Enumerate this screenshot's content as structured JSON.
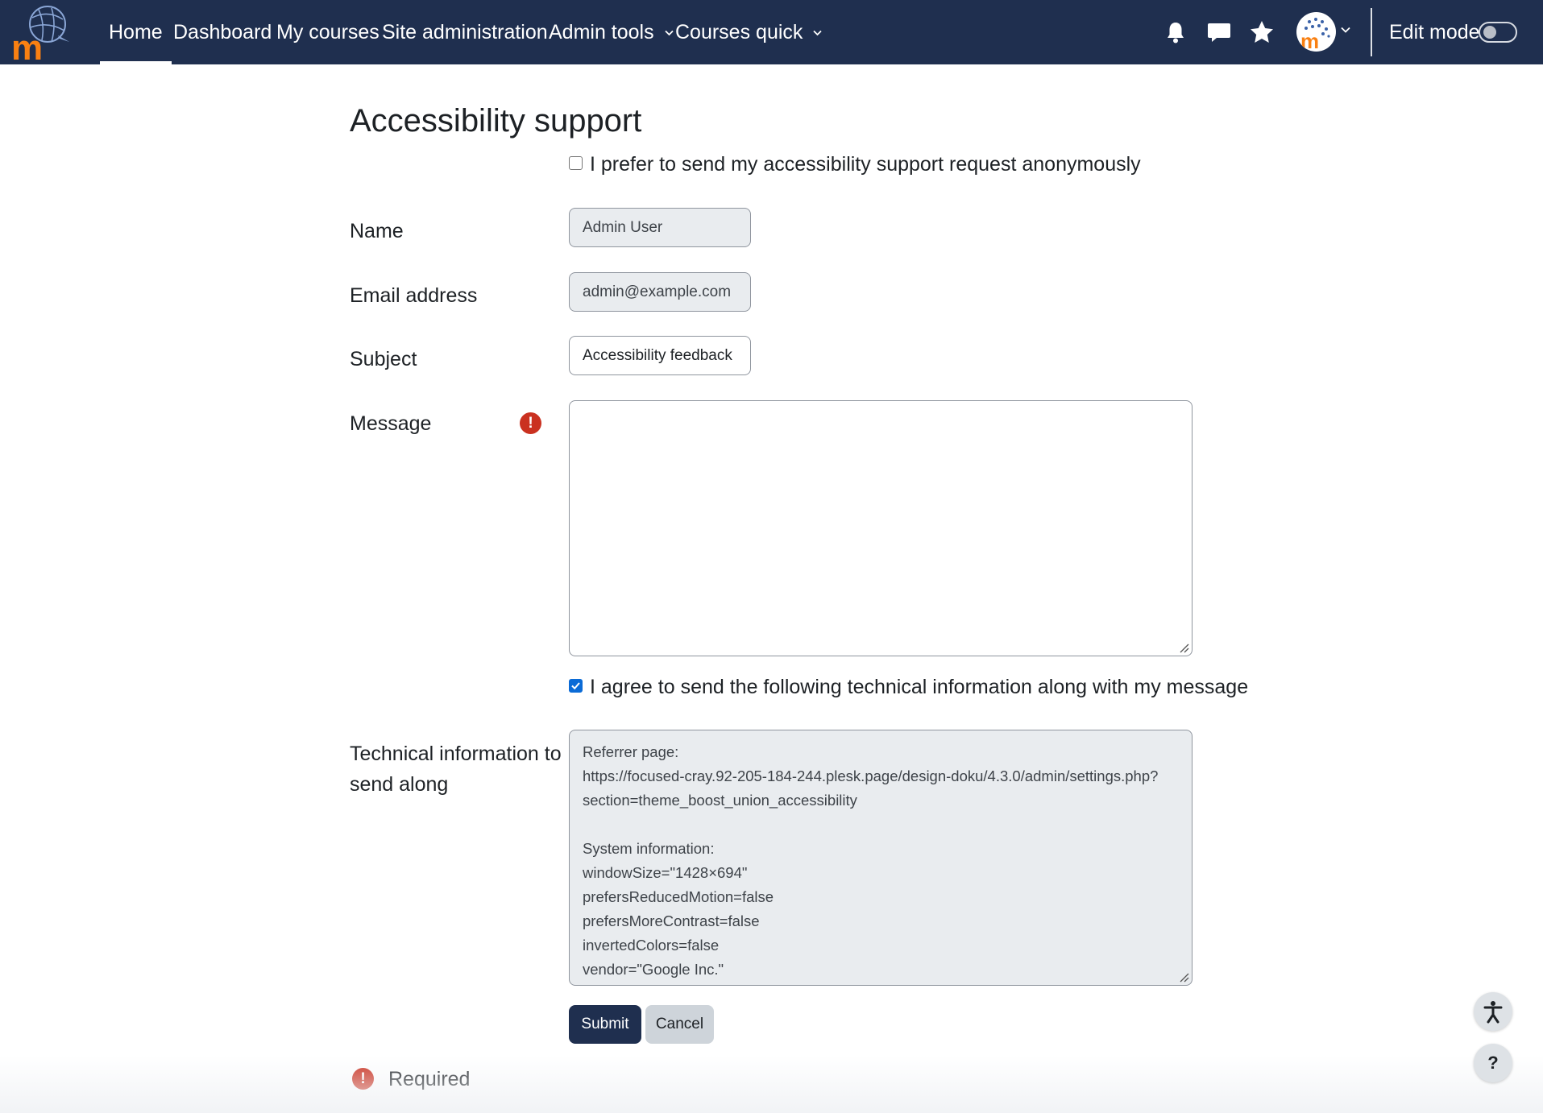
{
  "navbar": {
    "items": [
      {
        "label": "Home",
        "active": true
      },
      {
        "label": "Dashboard"
      },
      {
        "label": "My courses"
      },
      {
        "label": "Site administration"
      },
      {
        "label": "Admin tools",
        "dropdown": true
      },
      {
        "label": "Courses quick",
        "dropdown": true
      }
    ],
    "icons": [
      "bell-icon",
      "chat-icon",
      "star-icon"
    ],
    "edit_mode_label": "Edit mode",
    "edit_mode_on": false,
    "bg_color": "#1f2f4f"
  },
  "page": {
    "title": "Accessibility support"
  },
  "form": {
    "anonymous_label": "I prefer to send my accessibility support request anonymously",
    "anonymous_checked": false,
    "name_label": "Name",
    "name_value": "Admin User",
    "email_label": "Email address",
    "email_value": "admin@example.com",
    "subject_label": "Subject",
    "subject_value": "Accessibility feedback",
    "message_label": "Message",
    "message_value": "",
    "required_icon": "!",
    "techinfo_agree_label": "I agree to send the following technical information along with my message",
    "techinfo_agree_checked": true,
    "techinfo_label_line1": "Technical information to",
    "techinfo_label_line2": "send along",
    "techinfo_lines": [
      "Referrer page:",
      "https://focused-cray.92-205-184-244.plesk.page/design-doku/4.3.0/admin/settings.php?",
      "section=theme_boost_union_accessibility",
      "",
      "System information:",
      "windowSize=\"1428×694\"",
      "prefersReducedMotion=false",
      "prefersMoreContrast=false",
      "invertedColors=false",
      "vendor=\"Google Inc.\""
    ],
    "submit_label": "Submit",
    "cancel_label": "Cancel",
    "required_label": "Required"
  },
  "floating": {
    "accessibility_icon": "accessibility-icon",
    "help_label": "?"
  }
}
